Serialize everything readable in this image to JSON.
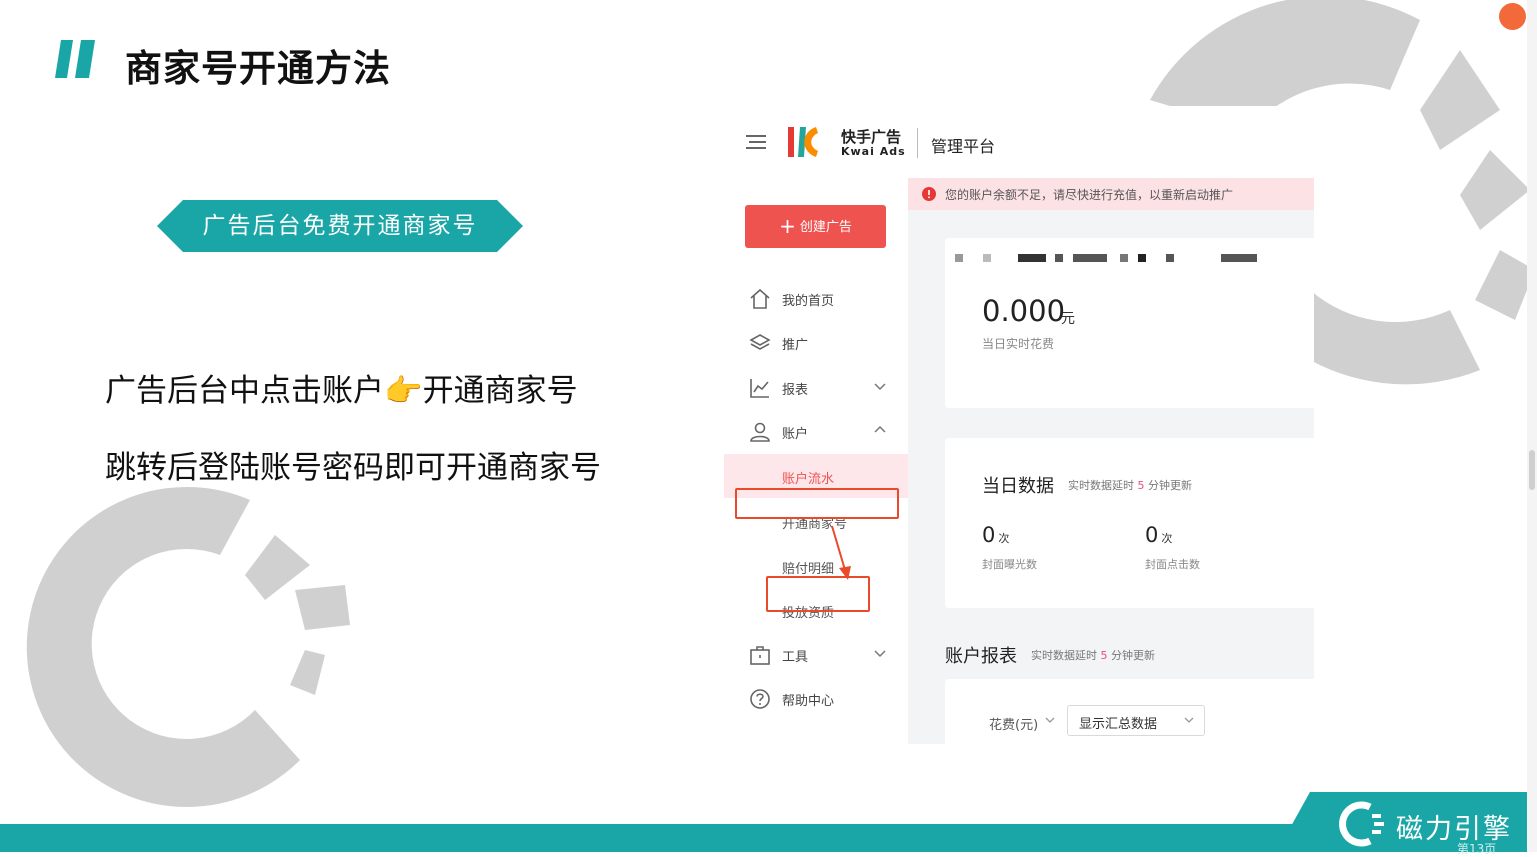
{
  "slide": {
    "title": "商家号开通方法",
    "banner": "广告后台免费开通商家号",
    "instruction_1": "广告后台中点击账户👉开通商家号",
    "instruction_2": "跳转后登陆账号密码即可开通商家号"
  },
  "platform": {
    "brand_cn": "快手广告",
    "brand_en": "Kwai Ads",
    "title": "管理平台",
    "create_button": "创建广告",
    "alert": "您的账户余额不足，请尽快进行充值，以重新启动推广",
    "nav": [
      {
        "label": "我的首页",
        "icon": "home-icon"
      },
      {
        "label": "推广",
        "icon": "layers-icon"
      },
      {
        "label": "报表",
        "icon": "chart-icon"
      },
      {
        "label": "账户",
        "icon": "user-icon"
      },
      {
        "label": "工具",
        "icon": "toolbox-icon"
      },
      {
        "label": "帮助中心",
        "icon": "help-icon"
      }
    ],
    "account_sub": [
      "账户流水",
      "开通商家号",
      "赔付明细",
      "投放资质"
    ],
    "balance": {
      "value": "0.000",
      "unit": "元",
      "label": "当日实时花费"
    },
    "daily": {
      "title": "当日数据",
      "note_prefix": "实时数据延时",
      "note_number": "5",
      "note_suffix": "分钟更新",
      "stats": [
        {
          "value": "0",
          "unit": "次",
          "label": "封面曝光数"
        },
        {
          "value": "0",
          "unit": "次",
          "label": "封面点击数"
        }
      ]
    },
    "report": {
      "title": "账户报表",
      "note_prefix": "实时数据延时",
      "note_number": "5",
      "note_suffix": "分钟更新",
      "spend_label": "花费(元)",
      "summary_select": "显示汇总数据"
    }
  },
  "footer": {
    "brand": "磁力引擎",
    "page": "第13页"
  },
  "colors": {
    "teal": "#1aa6a6",
    "create_button": "#ef5350",
    "highlight": "#e84a2a",
    "alert_bg": "#fde2e5"
  }
}
